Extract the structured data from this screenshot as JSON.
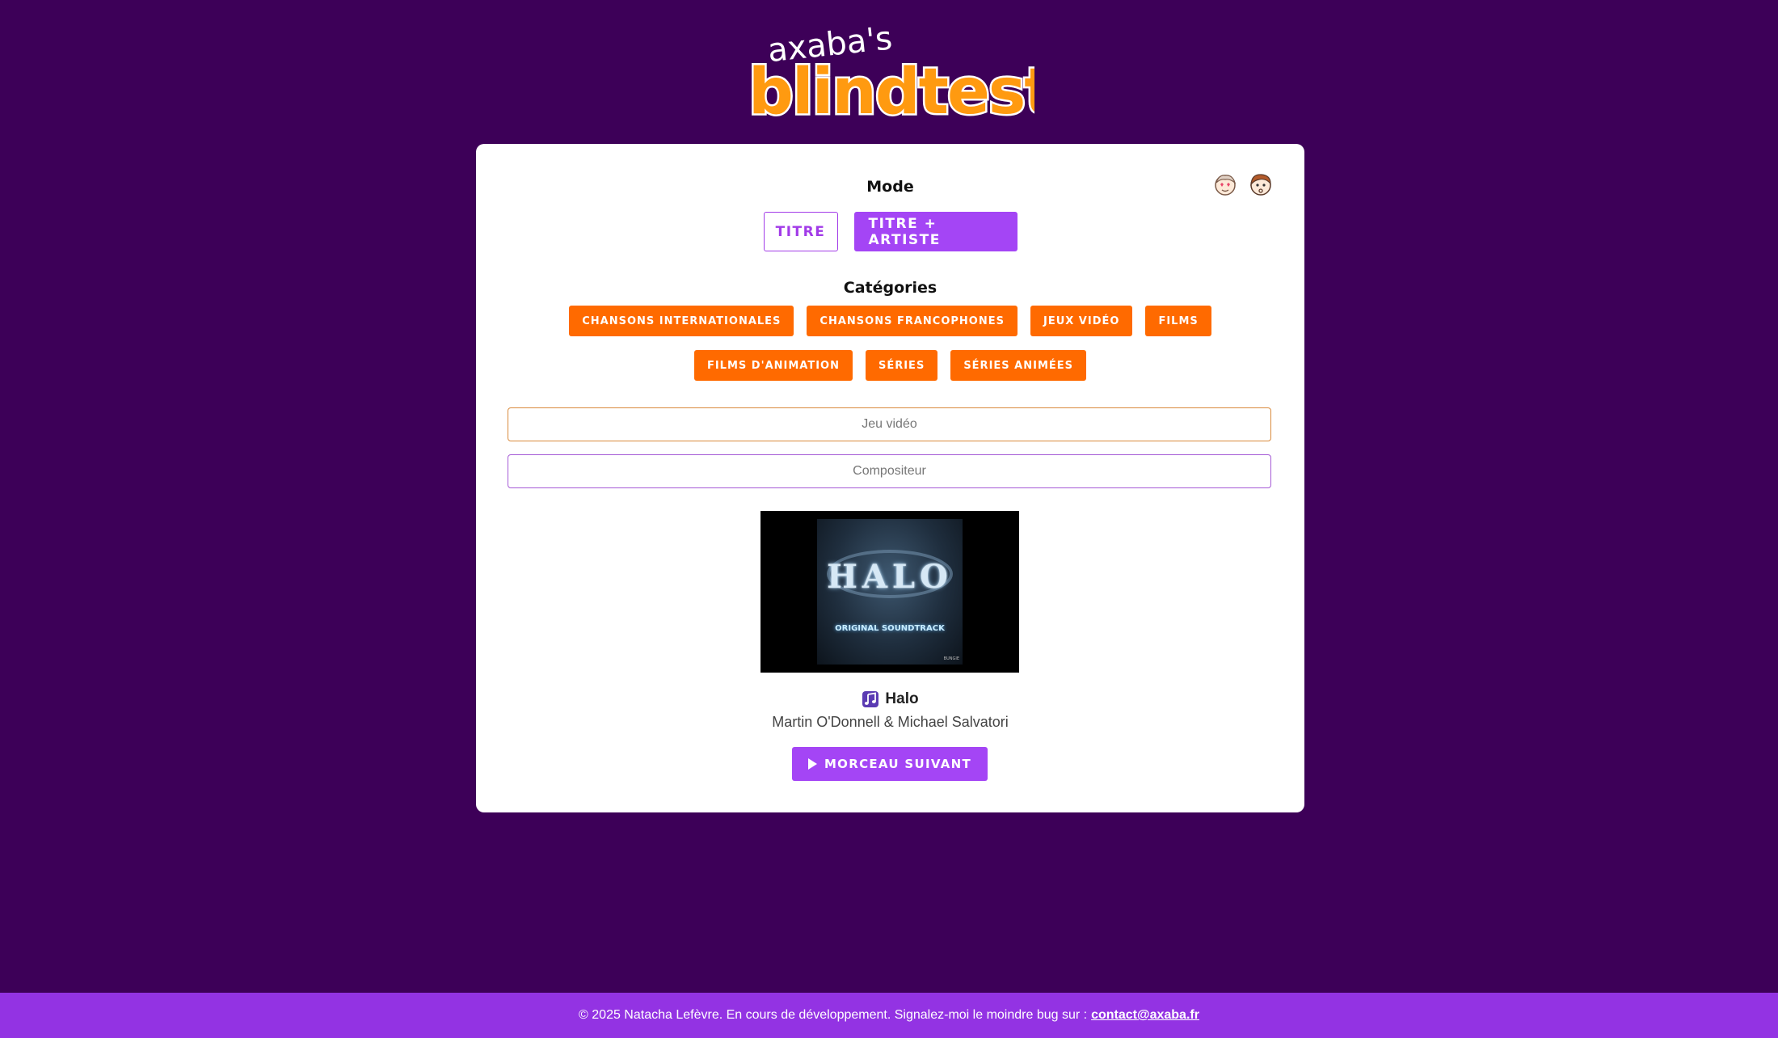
{
  "logo": {
    "top_text": "axaba's",
    "main_text": "blindtest"
  },
  "colors": {
    "background": "#3d0058",
    "accent_purple": "#a445f5",
    "accent_orange": "#ff6a00",
    "footer": "#9333e3"
  },
  "avatars": [
    {
      "name": "heart-eyes-avatar-icon"
    },
    {
      "name": "thinking-avatar-icon"
    }
  ],
  "mode": {
    "title": "Mode",
    "options": [
      {
        "label": "TITRE",
        "selected": false
      },
      {
        "label": "TITRE + ARTISTE",
        "selected": true
      }
    ]
  },
  "categories": {
    "title": "Catégories",
    "row1": [
      "CHANSONS INTERNATIONALES",
      "CHANSONS FRANCOPHONES",
      "JEUX VIDÉO",
      "FILMS"
    ],
    "row2": [
      "FILMS D'ANIMATION",
      "SÉRIES",
      "SÉRIES ANIMÉES"
    ]
  },
  "inputs": {
    "game_placeholder": "Jeu vidéo",
    "composer_placeholder": "Compositeur"
  },
  "cover": {
    "logo_text": "HALO",
    "subtitle": "ORIGINAL SOUNDTRACK",
    "badge": "BUNGIE"
  },
  "track": {
    "title": "Halo",
    "artist": "Martin O'Donnell & Michael Salvatori"
  },
  "next_button": {
    "label": "MORCEAU SUIVANT"
  },
  "footer": {
    "text": "© 2025 Natacha Lefèvre. En cours de développement. Signalez-moi le moindre bug sur :",
    "email": "contact@axaba.fr"
  }
}
